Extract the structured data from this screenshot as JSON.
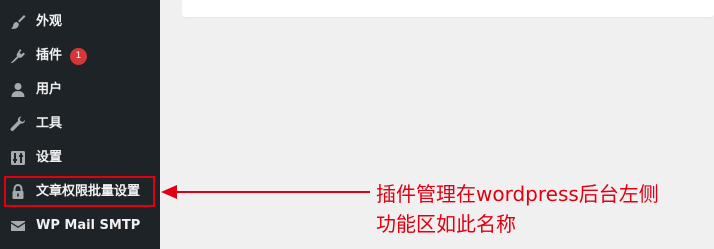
{
  "sidebar": {
    "background": "#1d2327",
    "text_color": "#f0f0f1",
    "items": [
      {
        "label": "外观",
        "icon": "paintbrush-icon"
      },
      {
        "label": "插件",
        "icon": "plugin-icon",
        "badge": "1"
      },
      {
        "label": "用户",
        "icon": "user-icon"
      },
      {
        "label": "工具",
        "icon": "wrench-icon"
      },
      {
        "label": "设置",
        "icon": "settings-icon"
      },
      {
        "label": "文章权限批量设置",
        "icon": "lock-icon"
      },
      {
        "label": "WP Mail SMTP",
        "icon": "mail-icon"
      }
    ]
  },
  "annotation": {
    "line1": "插件管理在wordpress后台左侧",
    "line2": "功能区如此名称",
    "color": "#e00012"
  },
  "badge_color": "#d63638"
}
